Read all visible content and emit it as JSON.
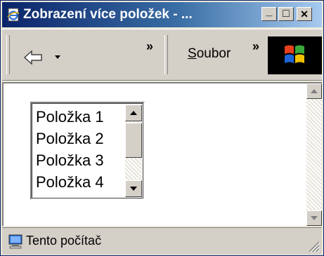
{
  "window": {
    "title": "Zobrazení více položek - ...",
    "buttons": {
      "minimize": "_",
      "maximize": "□",
      "close": "✕"
    }
  },
  "toolbar": {
    "back_icon": "back-arrow-icon",
    "chevron": "»",
    "menu_file_mnemonic": "S",
    "menu_file_rest": "oubor"
  },
  "listbox": {
    "items": [
      "Položka 1",
      "Položka 2",
      "Položka 3",
      "Položka 4"
    ]
  },
  "status": {
    "text": "Tento počítač",
    "icon": "computer-icon"
  }
}
